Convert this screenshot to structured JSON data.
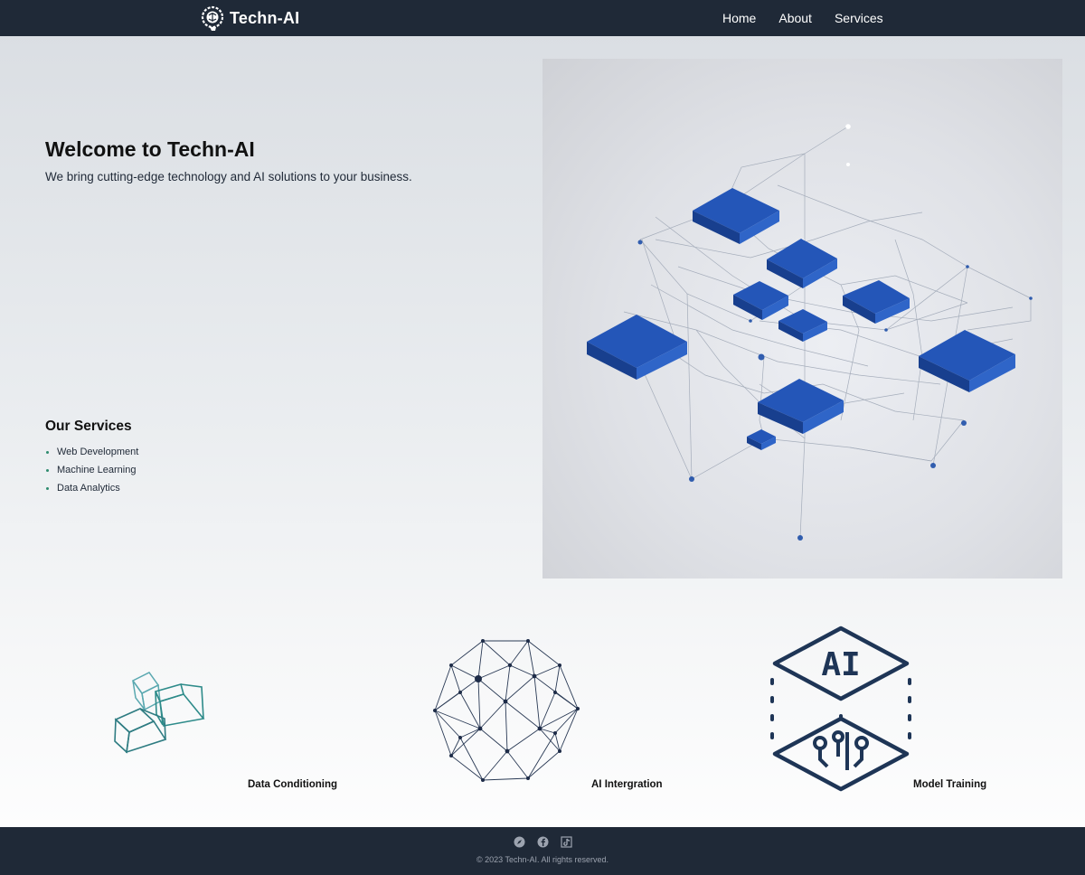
{
  "navbar": {
    "brand": "Techn-AI",
    "links": [
      {
        "label": "Home"
      },
      {
        "label": "About"
      },
      {
        "label": "Services"
      }
    ]
  },
  "hero": {
    "title": "Welcome to Techn-AI",
    "subtitle": "We bring cutting-edge technology and AI solutions to your business.",
    "services_heading": "Our Services",
    "services": [
      "Web Development",
      "Machine Learning",
      "Data Analytics"
    ]
  },
  "features": [
    {
      "label": "Data Conditioning",
      "icon": "cubes-icon"
    },
    {
      "label": "AI Intergration",
      "icon": "geodesic-sphere-icon"
    },
    {
      "label": "Model Training",
      "icon": "ai-chip-icon"
    }
  ],
  "footer": {
    "social_icons": [
      "compass-icon",
      "facebook-icon",
      "tiktok-icon"
    ],
    "copyright": "© 2023 Techn-AI. All rights reserved."
  },
  "colors": {
    "navbar_bg": "#1f2937",
    "accent_blue": "#1e4fa8",
    "icon_navy": "#1e3556",
    "icon_teal": "#2e8b8a"
  }
}
